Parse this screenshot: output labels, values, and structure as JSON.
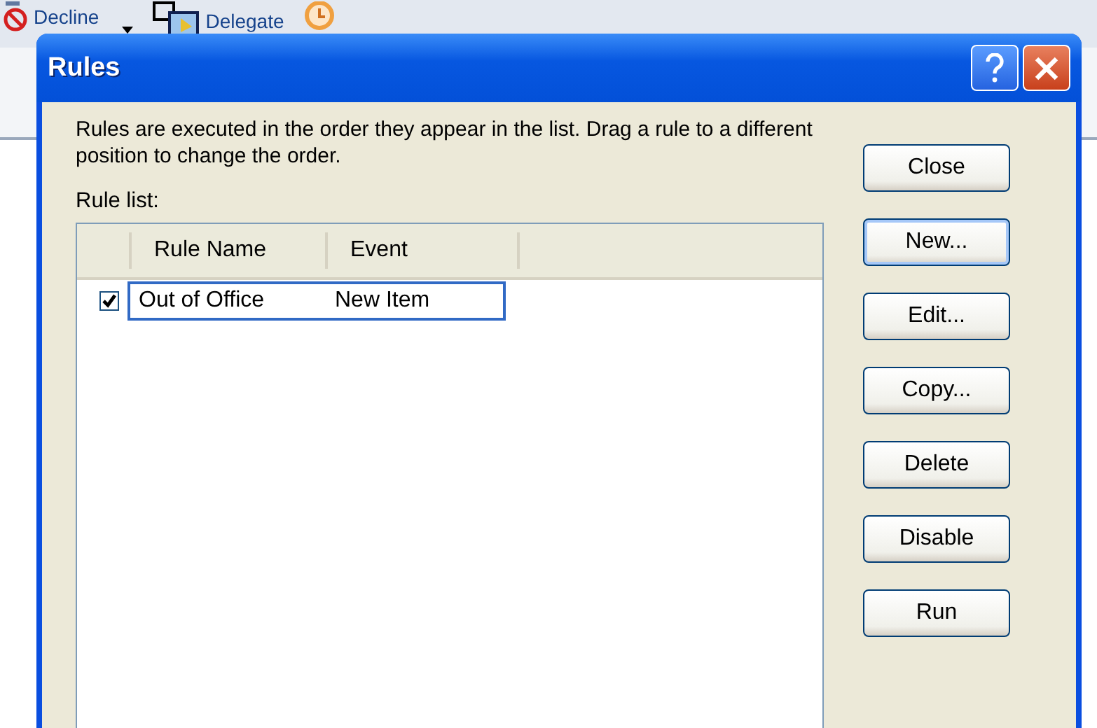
{
  "toolbar": {
    "items": [
      {
        "kind": "decline",
        "label": "Decline"
      },
      {
        "kind": "delegate",
        "label": "Delegate"
      },
      {
        "kind": "clock"
      }
    ]
  },
  "dialog": {
    "title": "Rules",
    "description": "Rules are executed in the order they appear in the list.  Drag a rule to a different position to change the order.",
    "list_label": "Rule list:",
    "table": {
      "columns": [
        "Rule Name",
        "Event"
      ],
      "rows": [
        {
          "checked": true,
          "selected": true,
          "cells": [
            "Out of Office",
            "New Item"
          ]
        }
      ]
    },
    "buttons": [
      {
        "label": "Close",
        "focused": false
      },
      {
        "label": "New...",
        "focused": true
      },
      {
        "label": "Edit...",
        "focused": false
      },
      {
        "label": "Copy...",
        "focused": false
      },
      {
        "label": "Delete",
        "focused": false
      },
      {
        "label": "Disable",
        "focused": false
      },
      {
        "label": "Run",
        "focused": false
      }
    ]
  }
}
